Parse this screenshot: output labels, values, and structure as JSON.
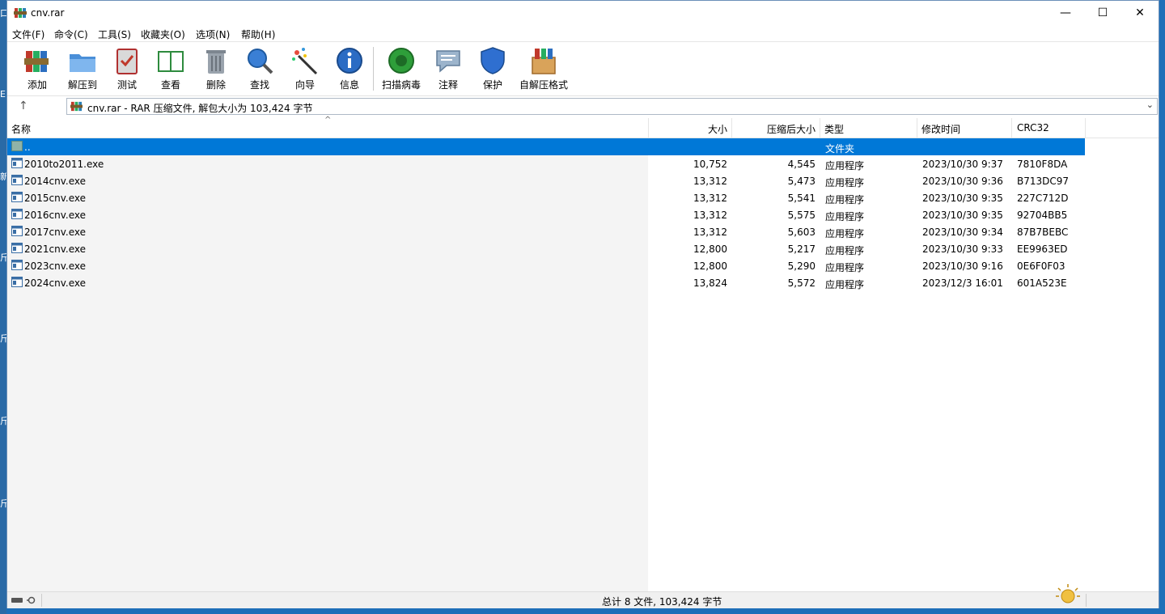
{
  "window": {
    "title": "cnv.rar",
    "minimize_icon": "minimize-icon",
    "maximize_icon": "maximize-icon",
    "close_icon": "close-icon"
  },
  "menu": [
    "文件(F)",
    "命令(C)",
    "工具(S)",
    "收藏夹(O)",
    "选项(N)",
    "帮助(H)"
  ],
  "toolbar": {
    "add": "添加",
    "extract": "解压到",
    "test": "测试",
    "view": "查看",
    "delete": "删除",
    "find": "查找",
    "wizard": "向导",
    "info": "信息",
    "scan": "扫描病毒",
    "comment": "注释",
    "protect": "保护",
    "sfx": "自解压格式"
  },
  "address": {
    "text": "cnv.rar - RAR 压缩文件, 解包大小为 103,424 字节"
  },
  "columns": {
    "name": "名称",
    "size": "大小",
    "packed": "压缩后大小",
    "type": "类型",
    "modified": "修改时间",
    "crc": "CRC32"
  },
  "rows": [
    {
      "name": "..",
      "size": "",
      "packed": "",
      "type": "文件夹",
      "modified": "",
      "crc": ""
    },
    {
      "name": "2010to2011.exe",
      "size": "10,752",
      "packed": "4,545",
      "type": "应用程序",
      "modified": "2023/10/30 9:37",
      "crc": "7810F8DA"
    },
    {
      "name": "2014cnv.exe",
      "size": "13,312",
      "packed": "5,473",
      "type": "应用程序",
      "modified": "2023/10/30 9:36",
      "crc": "B713DC97"
    },
    {
      "name": "2015cnv.exe",
      "size": "13,312",
      "packed": "5,541",
      "type": "应用程序",
      "modified": "2023/10/30 9:35",
      "crc": "227C712D"
    },
    {
      "name": "2016cnv.exe",
      "size": "13,312",
      "packed": "5,575",
      "type": "应用程序",
      "modified": "2023/10/30 9:35",
      "crc": "92704BB5"
    },
    {
      "name": "2017cnv.exe",
      "size": "13,312",
      "packed": "5,603",
      "type": "应用程序",
      "modified": "2023/10/30 9:34",
      "crc": "87B7BEBC"
    },
    {
      "name": "2021cnv.exe",
      "size": "12,800",
      "packed": "5,217",
      "type": "应用程序",
      "modified": "2023/10/30 9:33",
      "crc": "EE9963ED"
    },
    {
      "name": "2023cnv.exe",
      "size": "12,800",
      "packed": "5,290",
      "type": "应用程序",
      "modified": "2023/10/30 9:16",
      "crc": "0E6F0F03"
    },
    {
      "name": "2024cnv.exe",
      "size": "13,824",
      "packed": "5,572",
      "type": "应用程序",
      "modified": "2023/12/3 16:01",
      "crc": "601A523E"
    }
  ],
  "status": {
    "text": "总计 8 文件, 103,424 字节"
  },
  "colors": {
    "selection": "#0078d7",
    "desktop": "#1e6fb8"
  }
}
